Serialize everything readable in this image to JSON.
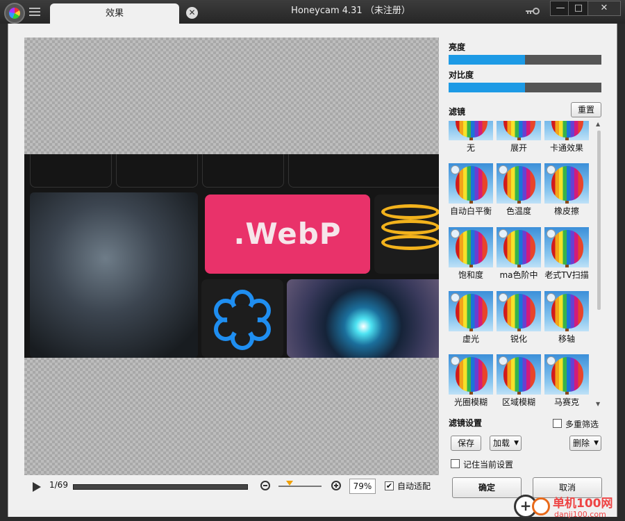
{
  "titlebar": {
    "tab_label": "效果",
    "tab_close_glyph": "✕",
    "title": "Honeycam 4.31  （未注册）",
    "minimize_glyph": "—",
    "maximize_glyph": "□",
    "close_glyph": "✕"
  },
  "preview": {
    "webp_text": ".WebP"
  },
  "playback": {
    "frame_counter": "1/69",
    "zoom_value": "79%",
    "auto_fit_label": "自动适配",
    "auto_fit_checked": "✔"
  },
  "adjust": {
    "brightness_label": "亮度",
    "brightness_value": 0.5,
    "contrast_label": "对比度",
    "contrast_value": 0.5
  },
  "filters": {
    "section_label": "滤镜",
    "reset_button": "重置",
    "items": [
      {
        "label": "无"
      },
      {
        "label": "展开"
      },
      {
        "label": "卡通效果"
      },
      {
        "label": "自动白平衡"
      },
      {
        "label": "色温度"
      },
      {
        "label": "橡皮擦"
      },
      {
        "label": "饱和度"
      },
      {
        "label": "ma色阶中"
      },
      {
        "label": "老式TV扫描"
      },
      {
        "label": "虚光"
      },
      {
        "label": "锐化"
      },
      {
        "label": "移轴"
      },
      {
        "label": "光圈模糊"
      },
      {
        "label": "区域模糊"
      },
      {
        "label": "马赛克"
      }
    ]
  },
  "filter_settings": {
    "label": "滤镜设置",
    "multi_filter_label": "多重筛选",
    "save_button": "保存",
    "load_button": "加载",
    "delete_button": "删除",
    "remember_label": "记住当前设置"
  },
  "footer": {
    "ok_button": "确定",
    "cancel_button": "取消"
  },
  "watermark": {
    "line1": "单机100网",
    "line2": "danji100.com",
    "glyph": "+"
  }
}
